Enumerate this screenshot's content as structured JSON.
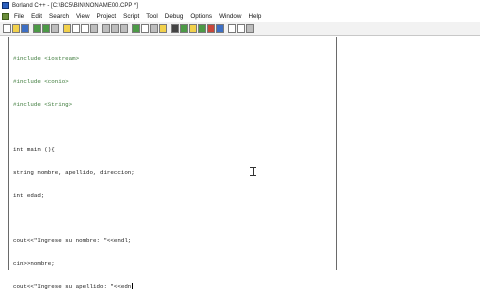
{
  "window": {
    "title": "Borland C++ - [C:\\BC5\\BIN\\NONAME00.CPP *]"
  },
  "menu": {
    "items": [
      {
        "label": "File"
      },
      {
        "label": "Edit"
      },
      {
        "label": "Search"
      },
      {
        "label": "View"
      },
      {
        "label": "Project"
      },
      {
        "label": "Script"
      },
      {
        "label": "Tool"
      },
      {
        "label": "Debug"
      },
      {
        "label": "Options"
      },
      {
        "label": "Window"
      },
      {
        "label": "Help"
      }
    ]
  },
  "toolbar": {
    "buttons": [
      {
        "icon": "new-file-icon"
      },
      {
        "icon": "open-folder-icon"
      },
      {
        "icon": "save-icon"
      },
      {
        "icon": "open-project-icon"
      },
      {
        "icon": "save-project-icon"
      },
      {
        "icon": "print-icon"
      },
      {
        "icon": "undo-icon"
      },
      {
        "icon": "cut-icon"
      },
      {
        "icon": "copy-icon"
      },
      {
        "icon": "paste-icon"
      },
      {
        "icon": "find-icon"
      },
      {
        "icon": "replace-icon"
      },
      {
        "icon": "search-again-icon"
      },
      {
        "icon": "compile-icon"
      },
      {
        "icon": "make-icon"
      },
      {
        "icon": "build-icon"
      },
      {
        "icon": "run-icon"
      },
      {
        "icon": "step-over-icon"
      },
      {
        "icon": "trace-into-icon"
      },
      {
        "icon": "toggle-breakpoint-icon"
      },
      {
        "icon": "inspect-icon"
      },
      {
        "icon": "watch-icon"
      },
      {
        "icon": "evaluate-icon"
      },
      {
        "icon": "window-tile-icon"
      },
      {
        "icon": "window-cascade-icon"
      },
      {
        "icon": "help-icon"
      }
    ]
  },
  "editor": {
    "lines": [
      "#include <iostream>",
      "#include <conio>",
      "#include <String>",
      "",
      "int main (){",
      "string nombre, apellido, direccion;",
      "int edad;",
      "",
      "cout<<\"Ingrese su nombre: \"<<endl;",
      "cin>>nombre;",
      "cout<<\"Ingrese su apellido: \"<<edn"
    ]
  },
  "colors": {
    "toolbar_bg": "#f2f2f2",
    "editor_bg": "#ffffff",
    "preprocessor": "#3c7a3a",
    "code_text": "#1a1a1a"
  }
}
